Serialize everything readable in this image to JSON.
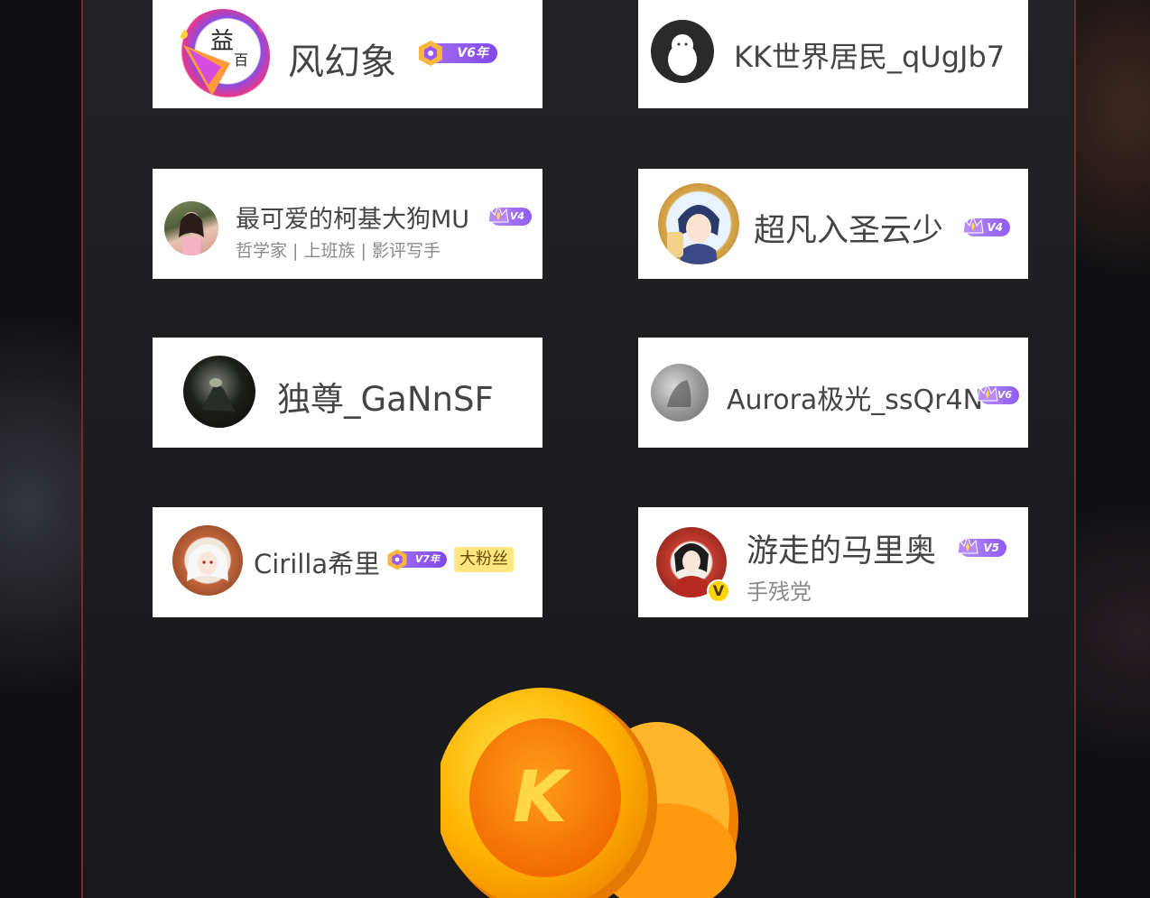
{
  "users": [
    {
      "name": "风幻象",
      "badge": "V6年",
      "badge_type": "year",
      "avatar_icon": "party-hat-avatar-icon"
    },
    {
      "name": "KK世界居民_qUgJb7",
      "avatar_icon": "default-ghost-avatar-icon"
    },
    {
      "name": "最可爱的柯基大狗MU",
      "badge": "V4",
      "badge_type": "vip",
      "subtitle": "哲学家 | 上班族 | 影评写手",
      "avatar_icon": "girl-photo-avatar-icon"
    },
    {
      "name": "超凡入圣云少",
      "badge": "V4",
      "badge_type": "vip",
      "avatar_icon": "anime-boy-avatar-icon"
    },
    {
      "name": "独尊_GaNnSF",
      "avatar_icon": "dark-photo-avatar-icon"
    },
    {
      "name": "Aurora极光_ssQr4N",
      "badge": "V6",
      "badge_type": "vip",
      "avatar_icon": "grey-sketch-avatar-icon"
    },
    {
      "name": "Cirilla希里",
      "badge": "V7年",
      "badge_type": "year",
      "tag": "大粉丝",
      "avatar_icon": "white-hair-anime-avatar-icon"
    },
    {
      "name": "游走的马里奥",
      "badge": "V5",
      "badge_type": "vip",
      "subtitle": "手残党",
      "verified_mark": "V",
      "avatar_icon": "red-anime-avatar-icon"
    }
  ],
  "coin": {
    "letter": "K",
    "icon": "kk-coin-stack-icon"
  },
  "colors": {
    "panel_border": "#7a2b24",
    "vip_purple": "#9b6bf4",
    "coin_orange": "#ff8a00",
    "fan_tag_bg": "#ffe680"
  }
}
